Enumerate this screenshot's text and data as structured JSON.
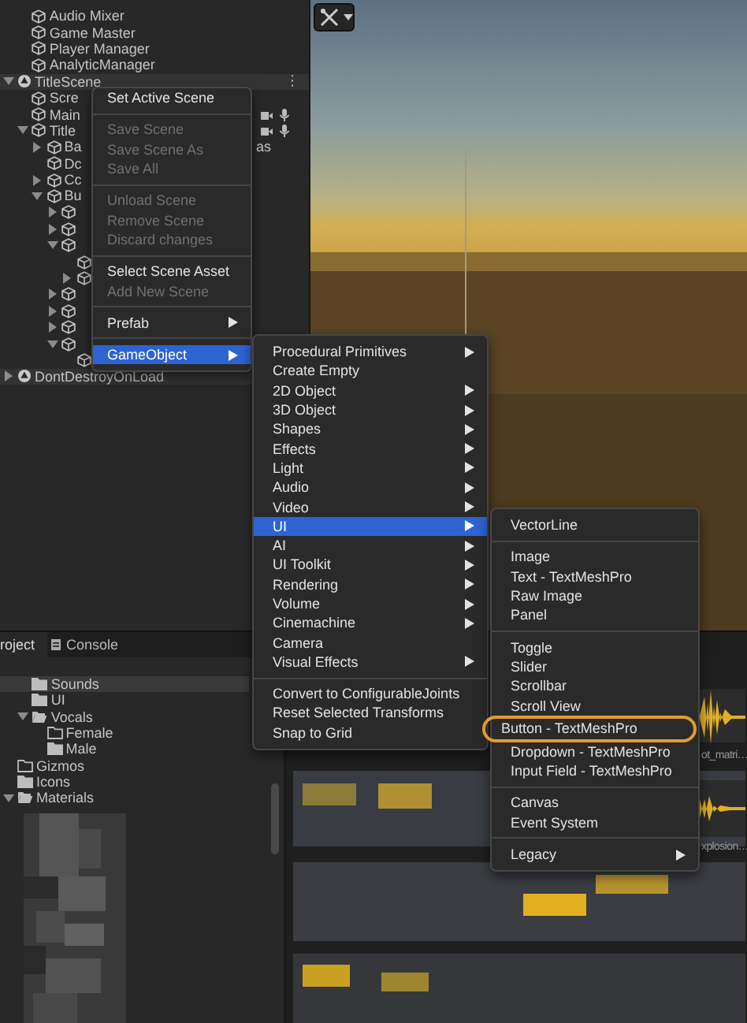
{
  "hierarchy": {
    "scenes": [
      {
        "items": [
          {
            "name": "Audio Mixer",
            "prefab": false
          },
          {
            "name": "Game Master",
            "prefab": false
          },
          {
            "name": "Player Manager",
            "prefab": false
          },
          {
            "name": "AnalyticManager",
            "prefab": false
          }
        ]
      },
      {
        "name": "TitleScene",
        "expanded": true,
        "menu_glyph": "⋮",
        "items": [
          {
            "name": "Scre",
            "prefab": false
          },
          {
            "name": "Main",
            "prefab": false,
            "component_icons": true
          },
          {
            "name": "Title",
            "prefab": false,
            "expanded": true,
            "component_icons": true,
            "children": [
              {
                "name": "Ba",
                "prefab": false,
                "expanded": false,
                "trailing": "as"
              },
              {
                "name": "Dc",
                "prefab": false
              },
              {
                "name": "Cc",
                "prefab": false,
                "expanded": false
              },
              {
                "name": "Bu",
                "prefab": false,
                "expanded": true,
                "children": [
                  {
                    "prefab": false,
                    "expanded": false
                  },
                  {
                    "prefab": false,
                    "expanded": false
                  },
                  {
                    "prefab": false,
                    "expanded": true,
                    "children": [
                      {
                        "prefab": false
                      },
                      {
                        "prefab": false,
                        "expanded": false
                      }
                    ]
                  },
                  {
                    "prefab": false,
                    "expanded": false
                  },
                  {
                    "prefab": false,
                    "expanded": false
                  },
                  {
                    "prefab": false,
                    "expanded": false
                  },
                  {
                    "prefab": false,
                    "expanded": true,
                    "children": [
                      {
                        "prefab": false
                      }
                    ]
                  }
                ]
              }
            ]
          }
        ]
      },
      {
        "name": "DontDestroyOnLoad",
        "expanded": false
      }
    ]
  },
  "context_menu": {
    "groups": [
      [
        {
          "label": "Set Active Scene",
          "disabled": false,
          "submenu": false,
          "selected": false
        }
      ],
      [
        {
          "label": "Save Scene",
          "disabled": true,
          "submenu": false,
          "selected": false
        },
        {
          "label": "Save Scene As",
          "disabled": true,
          "submenu": false,
          "selected": false
        },
        {
          "label": "Save All",
          "disabled": true,
          "submenu": false,
          "selected": false
        }
      ],
      [
        {
          "label": "Unload Scene",
          "disabled": true,
          "submenu": false,
          "selected": false
        },
        {
          "label": "Remove Scene",
          "disabled": true,
          "submenu": false,
          "selected": false
        },
        {
          "label": "Discard changes",
          "disabled": true,
          "submenu": false,
          "selected": false
        }
      ],
      [
        {
          "label": "Select Scene Asset",
          "disabled": false,
          "submenu": false,
          "selected": false
        },
        {
          "label": "Add New Scene",
          "disabled": true,
          "submenu": false,
          "selected": false
        }
      ],
      [
        {
          "label": "Prefab",
          "disabled": false,
          "submenu": true,
          "selected": false
        }
      ],
      [
        {
          "label": "GameObject",
          "disabled": false,
          "submenu": true,
          "selected": true
        }
      ]
    ]
  },
  "gameobject_menu": {
    "groups": [
      [
        {
          "label": "Procedural Primitives",
          "disabled": false,
          "submenu": true,
          "selected": false
        },
        {
          "label": "Create Empty",
          "disabled": false,
          "submenu": false,
          "selected": false
        },
        {
          "label": "2D Object",
          "disabled": false,
          "submenu": true,
          "selected": false
        },
        {
          "label": "3D Object",
          "disabled": false,
          "submenu": true,
          "selected": false
        },
        {
          "label": "Shapes",
          "disabled": false,
          "submenu": true,
          "selected": false
        },
        {
          "label": "Effects",
          "disabled": false,
          "submenu": true,
          "selected": false
        },
        {
          "label": "Light",
          "disabled": false,
          "submenu": true,
          "selected": false
        },
        {
          "label": "Audio",
          "disabled": false,
          "submenu": true,
          "selected": false
        },
        {
          "label": "Video",
          "disabled": false,
          "submenu": true,
          "selected": false
        },
        {
          "label": "UI",
          "disabled": false,
          "submenu": true,
          "selected": true
        },
        {
          "label": "AI",
          "disabled": false,
          "submenu": true,
          "selected": false
        },
        {
          "label": "UI Toolkit",
          "disabled": false,
          "submenu": true,
          "selected": false
        },
        {
          "label": "Rendering",
          "disabled": false,
          "submenu": true,
          "selected": false
        },
        {
          "label": "Volume",
          "disabled": false,
          "submenu": true,
          "selected": false
        },
        {
          "label": "Cinemachine",
          "disabled": false,
          "submenu": true,
          "selected": false
        },
        {
          "label": "Camera",
          "disabled": false,
          "submenu": false,
          "selected": false
        },
        {
          "label": "Visual Effects",
          "disabled": false,
          "submenu": true,
          "selected": false
        }
      ],
      [
        {
          "label": "Convert to ConfigurableJoints",
          "disabled": false,
          "submenu": false,
          "selected": false
        },
        {
          "label": "Reset Selected Transforms",
          "disabled": false,
          "submenu": false,
          "selected": false
        },
        {
          "label": "Snap to Grid",
          "disabled": false,
          "submenu": false,
          "selected": false
        }
      ]
    ]
  },
  "ui_menu": {
    "groups": [
      [
        {
          "label": "VectorLine",
          "disabled": false,
          "submenu": false,
          "selected": false
        }
      ],
      [
        {
          "label": "Image",
          "disabled": false,
          "submenu": false,
          "selected": false
        },
        {
          "label": "Text - TextMeshPro",
          "disabled": false,
          "submenu": false,
          "selected": false
        },
        {
          "label": "Raw Image",
          "disabled": false,
          "submenu": false,
          "selected": false
        },
        {
          "label": "Panel",
          "disabled": false,
          "submenu": false,
          "selected": false
        }
      ],
      [
        {
          "label": "Toggle",
          "disabled": false,
          "submenu": false,
          "selected": false
        },
        {
          "label": "Slider",
          "disabled": false,
          "submenu": false,
          "selected": false
        },
        {
          "label": "Scrollbar",
          "disabled": false,
          "submenu": false,
          "selected": false
        },
        {
          "label": "Scroll View",
          "disabled": false,
          "submenu": false,
          "selected": false
        },
        {
          "label": "Button - TextMeshPro",
          "disabled": false,
          "submenu": false,
          "selected": false,
          "circled": true
        },
        {
          "label": "Dropdown - TextMeshPro",
          "disabled": false,
          "submenu": false,
          "selected": false
        },
        {
          "label": "Input Field - TextMeshPro",
          "disabled": false,
          "submenu": false,
          "selected": false
        }
      ],
      [
        {
          "label": "Canvas",
          "disabled": false,
          "submenu": false,
          "selected": false
        },
        {
          "label": "Event System",
          "disabled": false,
          "submenu": false,
          "selected": false
        }
      ],
      [
        {
          "label": "Legacy",
          "disabled": false,
          "submenu": true,
          "selected": false
        }
      ]
    ]
  },
  "project_panel": {
    "tabs": [
      {
        "label": "roject",
        "selected": true
      },
      {
        "label": "Console",
        "selected": false
      }
    ],
    "folders": [
      {
        "children": [
          {
            "name": "Sounds",
            "selected": true,
            "empty": false
          },
          {
            "name": "UI",
            "selected": false,
            "empty": false
          },
          {
            "name": "Vocals",
            "selected": false,
            "empty": false,
            "expanded": true,
            "children": [
              {
                "name": "Female",
                "selected": false,
                "empty": true
              },
              {
                "name": "Male",
                "selected": false,
                "empty": false
              }
            ]
          }
        ]
      },
      {
        "name": "Gizmos",
        "selected": false,
        "empty": true
      },
      {
        "name": "Icons",
        "selected": false,
        "empty": false
      },
      {
        "name": "Materials",
        "selected": false,
        "empty": false,
        "expanded": true
      }
    ],
    "asset_labels": [
      "ot_matri…",
      "xplosion…"
    ]
  }
}
